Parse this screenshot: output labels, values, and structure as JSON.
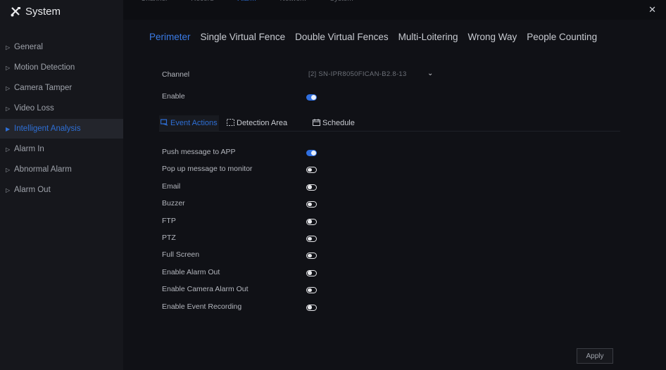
{
  "sidebar": {
    "title": "System",
    "items": [
      {
        "label": "General",
        "active": false
      },
      {
        "label": "Motion Detection",
        "active": false
      },
      {
        "label": "Camera Tamper",
        "active": false
      },
      {
        "label": "Video Loss",
        "active": false
      },
      {
        "label": "Intelligent Analysis",
        "active": true
      },
      {
        "label": "Alarm In",
        "active": false
      },
      {
        "label": "Abnormal Alarm",
        "active": false
      },
      {
        "label": "Alarm Out",
        "active": false
      }
    ]
  },
  "topnav": {
    "items": [
      {
        "label": "Channel",
        "active": false
      },
      {
        "label": "Record",
        "active": false
      },
      {
        "label": "Alarm",
        "active": true
      },
      {
        "label": "Network",
        "active": false
      },
      {
        "label": "System",
        "active": false
      }
    ]
  },
  "tabs": [
    {
      "label": "Perimeter",
      "active": true
    },
    {
      "label": "Single Virtual Fence",
      "active": false
    },
    {
      "label": "Double Virtual Fences",
      "active": false
    },
    {
      "label": "Multi-Loitering",
      "active": false
    },
    {
      "label": "Wrong Way",
      "active": false
    },
    {
      "label": "People Counting",
      "active": false
    }
  ],
  "form": {
    "channel_label": "Channel",
    "channel_value": "[2] SN-IPR8050FICAN-B2.8-13",
    "enable_label": "Enable",
    "enable_on": true
  },
  "subtabs": [
    {
      "label": "Event Actions",
      "active": true,
      "icon": "event-actions-icon"
    },
    {
      "label": "Detection Area",
      "active": false,
      "icon": "detection-area-icon"
    },
    {
      "label": "Schedule",
      "active": false,
      "icon": "calendar-icon"
    }
  ],
  "actions": [
    {
      "label": "Push message to APP",
      "on": true
    },
    {
      "label": "Pop up message to monitor",
      "on": false
    },
    {
      "label": "Email",
      "on": false
    },
    {
      "label": "Buzzer",
      "on": false
    },
    {
      "label": "FTP",
      "on": false
    },
    {
      "label": "PTZ",
      "on": false
    },
    {
      "label": "Full Screen",
      "on": false
    },
    {
      "label": "Enable Alarm Out",
      "on": false
    },
    {
      "label": "Enable Camera Alarm Out",
      "on": false
    },
    {
      "label": "Enable Event Recording",
      "on": false
    }
  ],
  "apply_label": "Apply",
  "colors": {
    "accent": "#2e6fd6",
    "background": "#0d0e12",
    "sidebar": "#16171c"
  }
}
